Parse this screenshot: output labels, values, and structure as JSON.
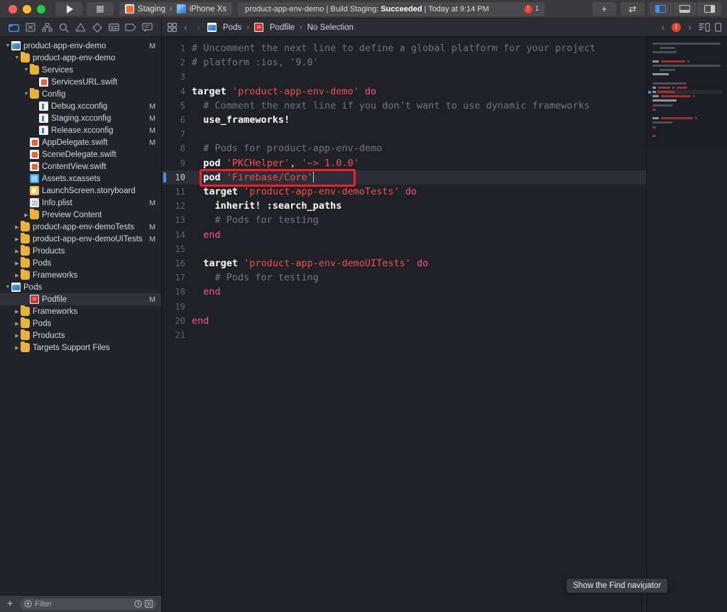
{
  "window": {
    "traffic_lights": [
      "close",
      "minimize",
      "zoom"
    ]
  },
  "toolbar": {
    "run_label": "Run",
    "stop_label": "Stop",
    "scheme": "Staging",
    "destination": "iPhone Xs",
    "scheme_separator": "›",
    "status_project": "product-app-env-demo",
    "status_middle": " | Build Staging: ",
    "status_result": "Succeeded",
    "status_time": " | Today at 9:14 PM",
    "error_badge": "!",
    "error_count": "1",
    "add_label": "+",
    "swap_label": "⇄",
    "panel_left_label": "Hide or show the Navigator",
    "panel_bottom_label": "Hide or show the Debug area",
    "panel_right_label": "Hide or show the Inspectors"
  },
  "navigator": {
    "tabs": [
      {
        "name": "project-navigator",
        "icon": "folder-icon",
        "active": true
      },
      {
        "name": "source-control-navigator",
        "icon": "source-control-icon",
        "active": false
      },
      {
        "name": "symbol-navigator",
        "icon": "hierarchy-icon",
        "active": false
      },
      {
        "name": "find-navigator",
        "icon": "search-icon",
        "active": false
      },
      {
        "name": "issue-navigator",
        "icon": "warning-triangle-icon",
        "active": false
      },
      {
        "name": "test-navigator",
        "icon": "diamond-icon",
        "active": false
      },
      {
        "name": "debug-navigator",
        "icon": "list-icon",
        "active": false
      },
      {
        "name": "breakpoint-navigator",
        "icon": "tag-icon",
        "active": false
      },
      {
        "name": "report-navigator",
        "icon": "speech-bubble-icon",
        "active": false
      }
    ],
    "tree": [
      {
        "label": "product-app-env-demo",
        "indent": 0,
        "twisty": "down",
        "icon": "project",
        "flag": "M",
        "selected": false
      },
      {
        "label": "product-app-env-demo",
        "indent": 1,
        "twisty": "down",
        "icon": "folder",
        "flag": "",
        "selected": false
      },
      {
        "label": "Services",
        "indent": 2,
        "twisty": "down",
        "icon": "folder",
        "flag": "",
        "selected": false
      },
      {
        "label": "ServicesURL.swift",
        "indent": 3,
        "twisty": "none",
        "icon": "swift",
        "flag": "",
        "selected": false
      },
      {
        "label": "Config",
        "indent": 2,
        "twisty": "down",
        "icon": "folder",
        "flag": "",
        "selected": false
      },
      {
        "label": "Debug.xcconfig",
        "indent": 3,
        "twisty": "none",
        "icon": "cfg",
        "flag": "M",
        "selected": false
      },
      {
        "label": "Staging.xcconfig",
        "indent": 3,
        "twisty": "none",
        "icon": "cfg",
        "flag": "M",
        "selected": false
      },
      {
        "label": "Release.xcconfig",
        "indent": 3,
        "twisty": "none",
        "icon": "cfg",
        "flag": "M",
        "selected": false
      },
      {
        "label": "AppDelegate.swift",
        "indent": 2,
        "twisty": "none",
        "icon": "swift",
        "flag": "M",
        "selected": false
      },
      {
        "label": "SceneDelegate.swift",
        "indent": 2,
        "twisty": "none",
        "icon": "swift",
        "flag": "",
        "selected": false
      },
      {
        "label": "ContentView.swift",
        "indent": 2,
        "twisty": "none",
        "icon": "swift",
        "flag": "",
        "selected": false
      },
      {
        "label": "Assets.xcassets",
        "indent": 2,
        "twisty": "none",
        "icon": "assets",
        "flag": "",
        "selected": false
      },
      {
        "label": "LaunchScreen.storyboard",
        "indent": 2,
        "twisty": "none",
        "icon": "story",
        "flag": "",
        "selected": false
      },
      {
        "label": "Info.plist",
        "indent": 2,
        "twisty": "none",
        "icon": "doc",
        "flag": "M",
        "selected": false
      },
      {
        "label": "Preview Content",
        "indent": 2,
        "twisty": "right",
        "icon": "folder",
        "flag": "",
        "selected": false
      },
      {
        "label": "product-app-env-demoTests",
        "indent": 1,
        "twisty": "right",
        "icon": "folder",
        "flag": "M",
        "selected": false
      },
      {
        "label": "product-app-env-demoUITests",
        "indent": 1,
        "twisty": "right",
        "icon": "folder",
        "flag": "M",
        "selected": false
      },
      {
        "label": "Products",
        "indent": 1,
        "twisty": "right",
        "icon": "folder",
        "flag": "",
        "selected": false
      },
      {
        "label": "Pods",
        "indent": 1,
        "twisty": "right",
        "icon": "folder",
        "flag": "",
        "selected": false
      },
      {
        "label": "Frameworks",
        "indent": 1,
        "twisty": "right",
        "icon": "folder",
        "flag": "",
        "selected": false
      },
      {
        "label": "Pods",
        "indent": 0,
        "twisty": "down",
        "icon": "project",
        "flag": "",
        "selected": false
      },
      {
        "label": "Podfile",
        "indent": 2,
        "twisty": "none",
        "icon": "rb",
        "flag": "M",
        "selected": true
      },
      {
        "label": "Frameworks",
        "indent": 1,
        "twisty": "right",
        "icon": "folder",
        "flag": "",
        "selected": false
      },
      {
        "label": "Pods",
        "indent": 1,
        "twisty": "right",
        "icon": "folder",
        "flag": "",
        "selected": false
      },
      {
        "label": "Products",
        "indent": 1,
        "twisty": "right",
        "icon": "folder",
        "flag": "",
        "selected": false
      },
      {
        "label": "Targets Support Files",
        "indent": 1,
        "twisty": "right",
        "icon": "folder",
        "flag": "",
        "selected": false
      }
    ],
    "filter": {
      "add_label": "+",
      "placeholder": "Filter",
      "recent_icon": "clock-icon",
      "scope_icon": "filter-scope-icon"
    }
  },
  "jumpbar": {
    "related_items_icon": "related-items-icon",
    "back_label": "‹",
    "forward_label": "›",
    "crumbs": [
      "Pods",
      "Podfile",
      "No Selection"
    ],
    "crumb_icons": [
      "project",
      "rb",
      "none"
    ],
    "error_badge": "!",
    "prev_issue_label": "‹",
    "next_issue_label": "›",
    "minimap_toggle_icon": "minimap-icon"
  },
  "editor": {
    "filename": "Podfile",
    "language": "ruby",
    "cursor_line": 10,
    "lines": [
      {
        "num": "1",
        "tokens": [
          {
            "t": "# Uncomment the next line to define a global platform for your project",
            "c": "cm"
          }
        ],
        "wrapped": true
      },
      {
        "num": "2",
        "tokens": [
          {
            "t": "# platform :ios, '9.0'",
            "c": "cm"
          }
        ]
      },
      {
        "num": "3",
        "tokens": []
      },
      {
        "num": "4",
        "tokens": [
          {
            "t": "target",
            "c": "fn"
          },
          {
            "t": " ",
            "c": "pn"
          },
          {
            "t": "'product-app-env-demo'",
            "c": "str"
          },
          {
            "t": " ",
            "c": "pn"
          },
          {
            "t": "do",
            "c": "kw"
          }
        ]
      },
      {
        "num": "5",
        "tokens": [
          {
            "t": "  # Comment the next line if you don't want to use dynamic frameworks",
            "c": "cm"
          }
        ],
        "wrapped": true
      },
      {
        "num": "6",
        "tokens": [
          {
            "t": "  use_frameworks!",
            "c": "fn"
          }
        ]
      },
      {
        "num": "7",
        "tokens": []
      },
      {
        "num": "8",
        "tokens": [
          {
            "t": "  # Pods for product-app-env-demo",
            "c": "cm"
          }
        ]
      },
      {
        "num": "9",
        "tokens": [
          {
            "t": "  ",
            "c": "pn"
          },
          {
            "t": "pod",
            "c": "fn"
          },
          {
            "t": " ",
            "c": "pn"
          },
          {
            "t": "'PKCHelper'",
            "c": "str"
          },
          {
            "t": ", ",
            "c": "pn"
          },
          {
            "t": "'~> 1.0.0'",
            "c": "str"
          }
        ]
      },
      {
        "num": "10",
        "tokens": [
          {
            "t": "  ",
            "c": "pn"
          },
          {
            "t": "pod",
            "c": "fn"
          },
          {
            "t": " ",
            "c": "pn"
          },
          {
            "t": "'Firebase/Core'",
            "c": "str"
          }
        ],
        "highlighted": true,
        "caret": true,
        "marker": true
      },
      {
        "num": "11",
        "tokens": [
          {
            "t": "  ",
            "c": "pn"
          },
          {
            "t": "target",
            "c": "fn"
          },
          {
            "t": " ",
            "c": "pn"
          },
          {
            "t": "'product-app-env-demoTests'",
            "c": "str"
          },
          {
            "t": " ",
            "c": "pn"
          },
          {
            "t": "do",
            "c": "kw"
          }
        ]
      },
      {
        "num": "12",
        "tokens": [
          {
            "t": "    inherit! :search_paths",
            "c": "fn"
          }
        ]
      },
      {
        "num": "13",
        "tokens": [
          {
            "t": "    # Pods for testing",
            "c": "cm"
          }
        ]
      },
      {
        "num": "14",
        "tokens": [
          {
            "t": "  ",
            "c": "pn"
          },
          {
            "t": "end",
            "c": "kw"
          }
        ]
      },
      {
        "num": "15",
        "tokens": []
      },
      {
        "num": "16",
        "tokens": [
          {
            "t": "  ",
            "c": "pn"
          },
          {
            "t": "target",
            "c": "fn"
          },
          {
            "t": " ",
            "c": "pn"
          },
          {
            "t": "'product-app-env-demoUITests'",
            "c": "str"
          },
          {
            "t": " ",
            "c": "pn"
          },
          {
            "t": "do",
            "c": "kw"
          }
        ]
      },
      {
        "num": "17",
        "tokens": [
          {
            "t": "    # Pods for testing",
            "c": "cm"
          }
        ]
      },
      {
        "num": "18",
        "tokens": [
          {
            "t": "  ",
            "c": "pn"
          },
          {
            "t": "end",
            "c": "kw"
          }
        ]
      },
      {
        "num": "19",
        "tokens": []
      },
      {
        "num": "20",
        "tokens": [
          {
            "t": "end",
            "c": "kw"
          }
        ]
      },
      {
        "num": "21",
        "tokens": []
      }
    ],
    "annotation": {
      "shape": "rectangle",
      "color": "#f41f2d",
      "target": "pod 'Firebase/Core'"
    }
  },
  "tooltip": {
    "text": "Show the Find navigator"
  },
  "colors": {
    "accent_blue": "#3b8fe8",
    "annotation_red": "#f41f2d",
    "string_red": "#f0514f",
    "keyword_pink": "#ff4f9a",
    "comment_gray": "#6f7680",
    "editor_bg": "#1f2127",
    "navigator_bg": "#22242a",
    "toolbar_bg": "#3a3a3c",
    "error_red": "#e8402c",
    "folder_yellow": "#e8b23a"
  }
}
